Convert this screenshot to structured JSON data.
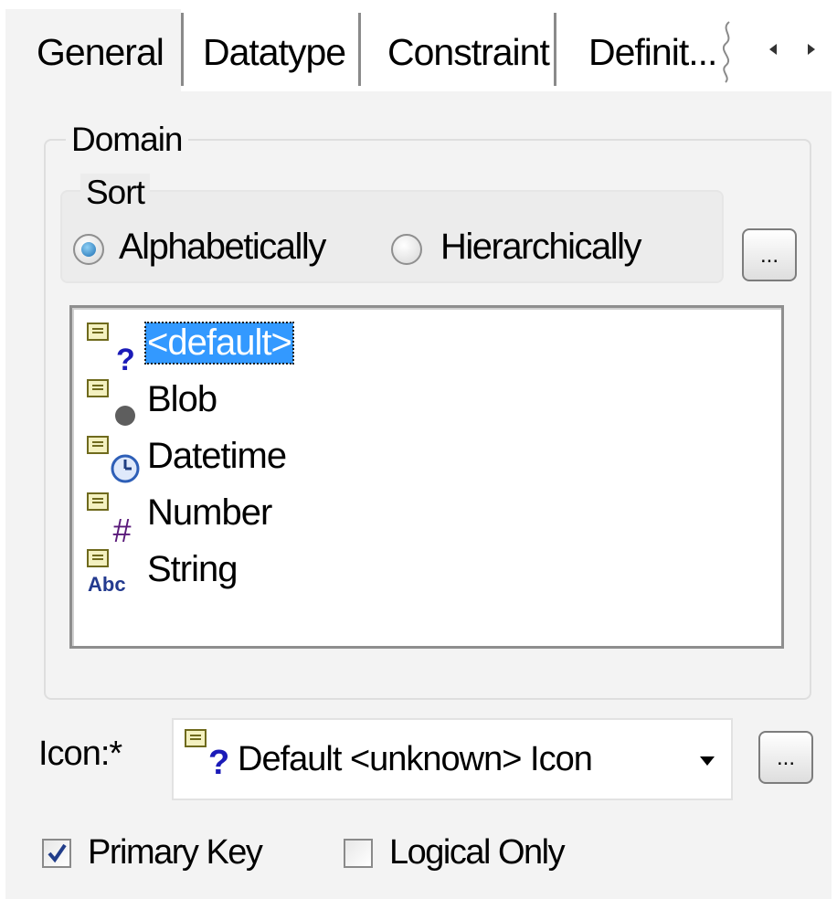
{
  "tabs": [
    {
      "label": "General",
      "active": true
    },
    {
      "label": "Datatype",
      "active": false
    },
    {
      "label": "Constraint",
      "active": false
    },
    {
      "label": "Definit...",
      "active": false
    }
  ],
  "domain": {
    "group_label": "Domain",
    "sort": {
      "group_label": "Sort",
      "options": [
        {
          "label": "Alphabetically",
          "selected": true
        },
        {
          "label": "Hierarchically",
          "selected": false
        }
      ]
    },
    "browse_button_label": "...",
    "items": [
      {
        "label": "<default>",
        "icon": "question-icon",
        "selected": true
      },
      {
        "label": "Blob",
        "icon": "blob-dot-icon",
        "selected": false
      },
      {
        "label": "Datetime",
        "icon": "clock-icon",
        "selected": false
      },
      {
        "label": "Number",
        "icon": "hash-icon",
        "selected": false
      },
      {
        "label": "String",
        "icon": "abc-icon",
        "selected": false
      }
    ]
  },
  "icon_field": {
    "label": "Icon:*",
    "value": "Default <unknown> Icon",
    "browse_button_label": "..."
  },
  "checkboxes": [
    {
      "label": "Primary Key",
      "checked": true
    },
    {
      "label": "Logical Only",
      "checked": false
    }
  ],
  "colors": {
    "selection": "#3399ff",
    "panel": "#f3f3f3",
    "question_mark": "#1b1bb8"
  }
}
